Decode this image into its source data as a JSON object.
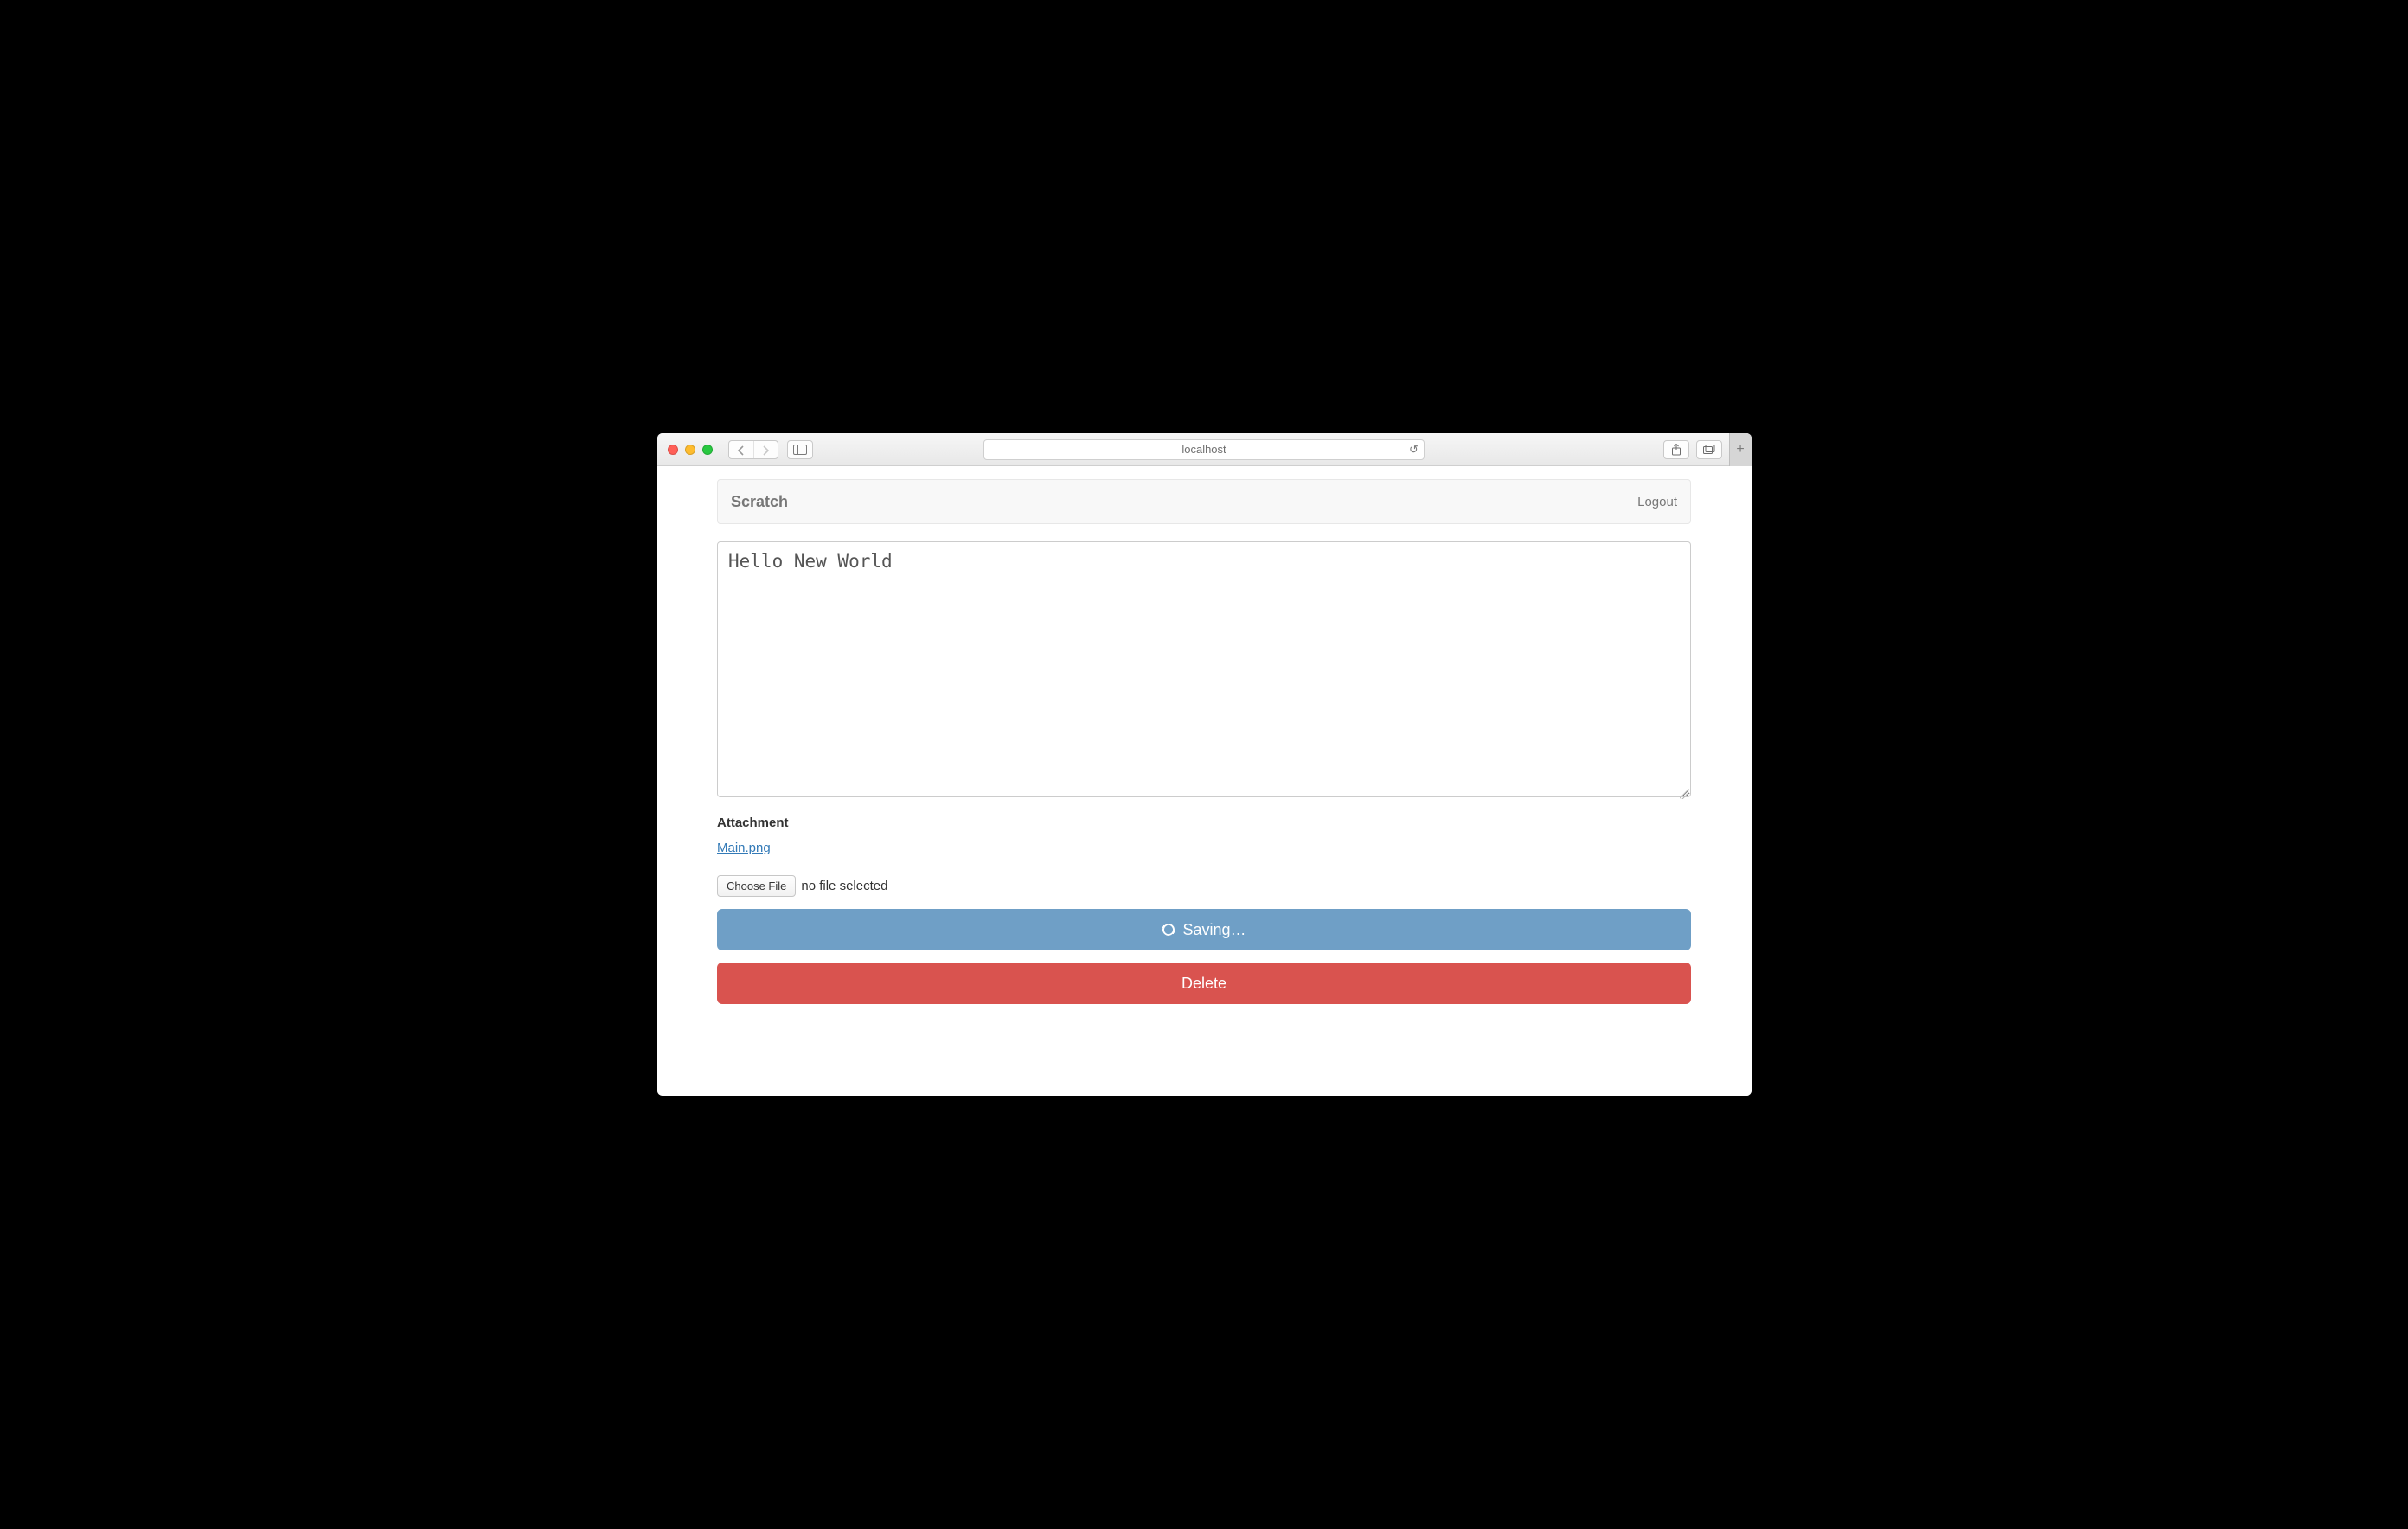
{
  "browser": {
    "address": "localhost"
  },
  "nav": {
    "brand": "Scratch",
    "logout": "Logout"
  },
  "editor": {
    "content": "Hello New World"
  },
  "attachment": {
    "heading": "Attachment",
    "link_label": "Main.png",
    "choose_label": "Choose File",
    "no_file_label": "no file selected"
  },
  "buttons": {
    "save_in_progress": "Saving…",
    "delete": "Delete"
  }
}
